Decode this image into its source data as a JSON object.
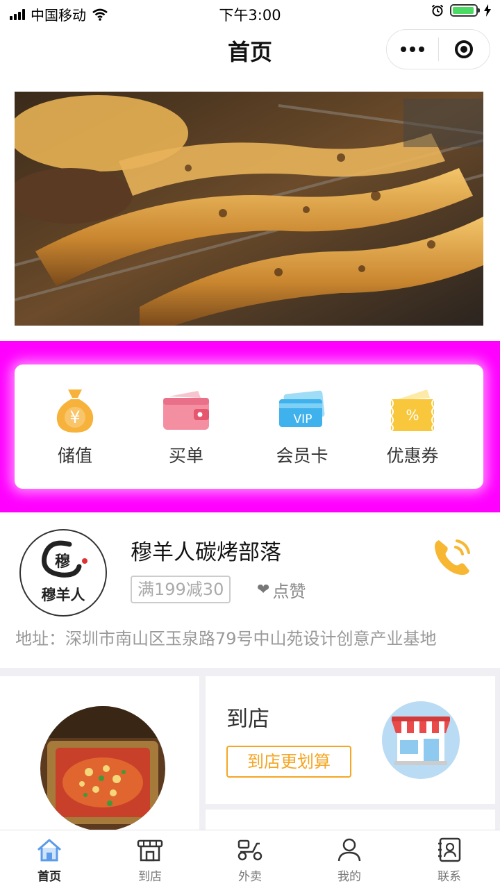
{
  "status_bar": {
    "carrier": "中国移动",
    "time": "下午3:00"
  },
  "nav": {
    "title": "首页"
  },
  "quick_menu": [
    {
      "label": "储值",
      "icon": "money-bag-icon"
    },
    {
      "label": "买单",
      "icon": "wallet-icon"
    },
    {
      "label": "会员卡",
      "icon": "vip-card-icon"
    },
    {
      "label": "优惠券",
      "icon": "coupon-icon"
    }
  ],
  "vip_text": "VIP",
  "coupon_text": "%",
  "money_text": "¥",
  "shop": {
    "name": "穆羊人碳烤部落",
    "logo_text": "穆羊人",
    "promo": "满199减30",
    "like_label": "点赞",
    "address": "地址：深圳市南山区玉泉路79号中山苑设计创意产业基地"
  },
  "store_card": {
    "title": "到店",
    "button": "到店更划算"
  },
  "tabbar": [
    {
      "label": "首页",
      "icon": "home-icon"
    },
    {
      "label": "到店",
      "icon": "store-icon"
    },
    {
      "label": "外卖",
      "icon": "scooter-icon"
    },
    {
      "label": "我的",
      "icon": "user-icon"
    },
    {
      "label": "联系",
      "icon": "contacts-icon"
    }
  ],
  "colors": {
    "accent": "#f5a623",
    "magenta": "#ff00ff",
    "tab_active": "#5b9bea"
  }
}
